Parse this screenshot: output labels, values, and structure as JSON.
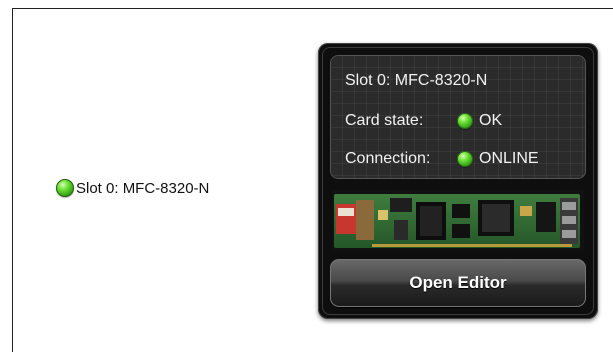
{
  "tree": {
    "slot_label": "Slot 0: MFC-8320-N",
    "status_color": "#3fb81a"
  },
  "card": {
    "title": "Slot 0: MFC-8320-N",
    "card_state_label": "Card state:",
    "card_state_value": "OK",
    "connection_label": "Connection:",
    "connection_value": "ONLINE",
    "image_icon": "circuit-board-photo",
    "open_editor_label": "Open Editor"
  }
}
